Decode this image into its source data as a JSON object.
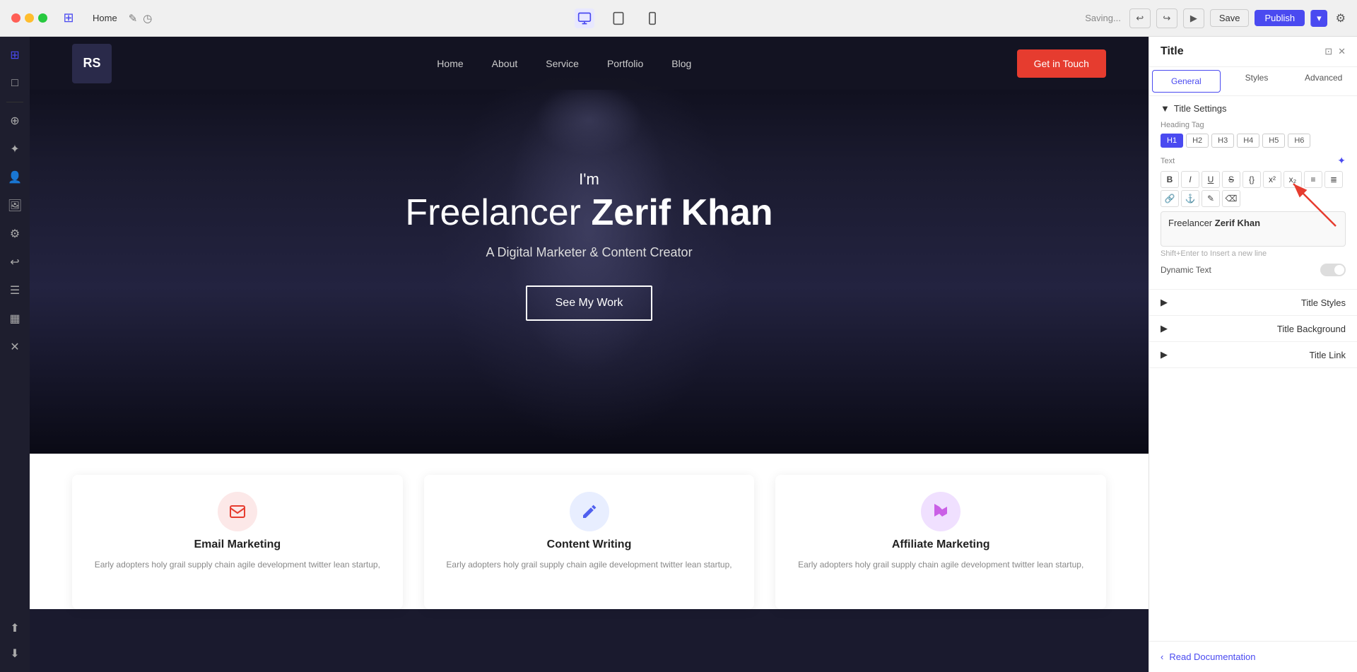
{
  "window": {
    "title": "Home"
  },
  "titlebar": {
    "home_tab": "Home",
    "saving_text": "Saving...",
    "save_label": "Save",
    "publish_label": "Publish",
    "undo_symbol": "↩",
    "redo_symbol": "↪",
    "preview_symbol": "▶"
  },
  "site": {
    "logo": "RS",
    "nav": {
      "links": [
        "Home",
        "About",
        "Service",
        "Portfolio",
        "Blog"
      ],
      "cta": "Get in Touch"
    },
    "hero": {
      "im": "I'm",
      "title_light": "Freelancer",
      "title_bold": "Zerif Khan",
      "subtitle": "A Digital Marketer & Content Creator",
      "cta": "See My Work"
    },
    "services": [
      {
        "title": "Email Marketing",
        "desc": "Early adopters holy grail supply chain agile development twitter lean startup,",
        "icon": "✉"
      },
      {
        "title": "Content Writing",
        "desc": "Early adopters holy grail supply chain agile development twitter lean startup,",
        "icon": "✏"
      },
      {
        "title": "Affiliate Marketing",
        "desc": "Early adopters holy grail supply chain agile development twitter lean startup,",
        "icon": "📢"
      }
    ]
  },
  "panel": {
    "title": "Title",
    "tabs": [
      "General",
      "Styles",
      "Advanced"
    ],
    "title_settings_header": "Title Settings",
    "heading_tag_label": "Heading Tag",
    "heading_tags": [
      "H1",
      "H2",
      "H3",
      "H4",
      "H5",
      "H6"
    ],
    "active_heading": "H1",
    "text_label": "Text",
    "text_content_light": "Freelancer ",
    "text_content_bold": "Zerif Khan",
    "text_hint": "Shift+Enter to Insert a new line",
    "dynamic_text_label": "Dynamic Text",
    "title_styles_label": "Title Styles",
    "title_background_label": "Title Background",
    "title_link_label": "Title Link",
    "read_docs_label": "Read Documentation",
    "format_buttons": [
      "B",
      "I",
      "U",
      "S",
      "{}",
      "x²",
      "x₂",
      "≡",
      "≣",
      "🔗",
      "⚓",
      "✎",
      "⌫"
    ]
  },
  "sidebar": {
    "icons": [
      "⊞",
      "□",
      "⊕",
      "✦",
      "👤",
      "🖼",
      "⚙",
      "↩",
      "☰",
      "▦",
      "✕"
    ],
    "bottom_icons": [
      "⬆",
      "⬇"
    ]
  }
}
